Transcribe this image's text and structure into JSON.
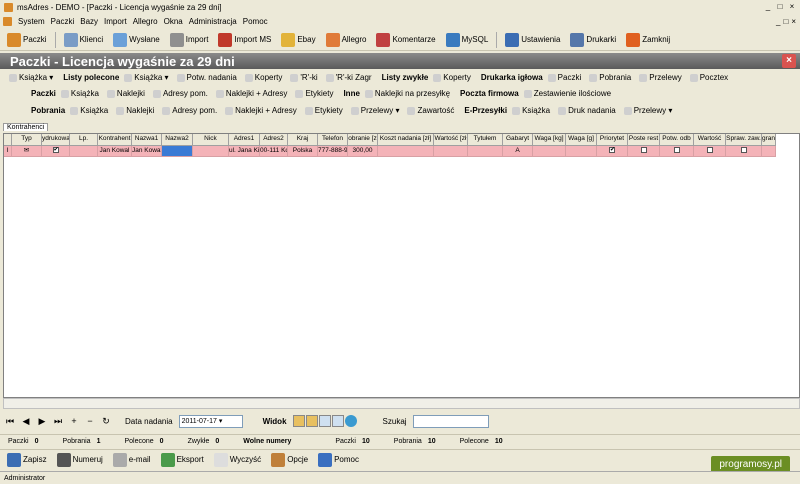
{
  "window": {
    "title": "msAdres - DEMO - [Paczki - Licencja wygaśnie za 29 dni]"
  },
  "menu": [
    "System",
    "Paczki",
    "Bazy",
    "Import",
    "Allegro",
    "Okna",
    "Administracja",
    "Pomoc"
  ],
  "toolbar": [
    {
      "label": "Paczki",
      "color": "#d98a2b"
    },
    {
      "label": "Klienci",
      "color": "#7a9cc6"
    },
    {
      "label": "Wysłane",
      "color": "#6aa0d8"
    },
    {
      "label": "Import",
      "color": "#8f8f8f"
    },
    {
      "label": "Import MS",
      "color": "#c0392b"
    },
    {
      "label": "Ebay",
      "color": "#e2b33a"
    },
    {
      "label": "Allegro",
      "color": "#e07b39"
    },
    {
      "label": "Komentarze",
      "color": "#c04040"
    },
    {
      "label": "MySQL",
      "color": "#3a7bbf"
    },
    {
      "label": "Ustawienia",
      "color": "#3b6db3"
    },
    {
      "label": "Drukarki",
      "color": "#5577aa"
    },
    {
      "label": "Zamknij",
      "color": "#e06020"
    }
  ],
  "header": {
    "title": "Paczki - Licencja wygaśnie za 29 dni"
  },
  "sub1": [
    {
      "t": "i",
      "l": "Książka ▾"
    },
    {
      "t": "g",
      "l": "Listy polecone"
    },
    {
      "t": "i",
      "l": "Książka ▾"
    },
    {
      "t": "i",
      "l": "Potw. nadania"
    },
    {
      "t": "i",
      "l": "Koperty"
    },
    {
      "t": "i",
      "l": "'R'-ki"
    },
    {
      "t": "i",
      "l": "'R'-ki Zagr"
    },
    {
      "t": "g",
      "l": "Listy zwykłe"
    },
    {
      "t": "i",
      "l": "Koperty"
    },
    {
      "t": "g",
      "l": "Drukarka igłowa"
    },
    {
      "t": "i",
      "l": "Paczki"
    },
    {
      "t": "i",
      "l": "Pobrania"
    },
    {
      "t": "i",
      "l": "Przelewy"
    },
    {
      "t": "i",
      "l": "Pocztex"
    }
  ],
  "sub2": [
    {
      "t": "g",
      "l": "Paczki"
    },
    {
      "t": "i",
      "l": "Książka"
    },
    {
      "t": "i",
      "l": "Naklejki"
    },
    {
      "t": "i",
      "l": "Adresy pom."
    },
    {
      "t": "i",
      "l": "Naklejki + Adresy"
    },
    {
      "t": "i",
      "l": "Etykiety"
    },
    {
      "t": "g",
      "l": "Inne"
    },
    {
      "t": "i",
      "l": "Naklejki na przesyłkę"
    },
    {
      "t": "g",
      "l": "Poczta firmowa"
    },
    {
      "t": "i",
      "l": "Zestawienie ilościowe"
    }
  ],
  "sub3": [
    {
      "t": "g",
      "l": "Pobrania"
    },
    {
      "t": "i",
      "l": "Książka"
    },
    {
      "t": "i",
      "l": "Naklejki"
    },
    {
      "t": "i",
      "l": "Adresy pom."
    },
    {
      "t": "i",
      "l": "Naklejki + Adresy"
    },
    {
      "t": "i",
      "l": "Etykiety"
    },
    {
      "t": "i",
      "l": "Przelewy ▾"
    },
    {
      "t": "i",
      "l": "Zawartość"
    },
    {
      "t": "g",
      "l": "E-Przesyłki"
    },
    {
      "t": "i",
      "l": "Książka"
    },
    {
      "t": "i",
      "l": "Druk nadania"
    },
    {
      "t": "i",
      "l": "Przelewy ▾"
    }
  ],
  "tab": "Kontrahenci",
  "columns": [
    "",
    "Typ",
    "ydrukowa",
    "Lp.",
    "Kontrahent",
    "Nazwa1",
    "Nazwa2",
    "Nick",
    "Adres1",
    "Adres2",
    "Kraj",
    "Telefon",
    "obranie [z",
    "Koszt nadania [zł]",
    "Wartość [zł",
    "Tytułem",
    "Gabaryt",
    "Waga [kg]",
    "Waga [g]",
    "Priorytet",
    "Poste rest",
    "Potw. odb",
    "Wartość",
    "Spraw. zaw.",
    "granica"
  ],
  "row": [
    "I",
    "✉",
    "✔",
    "",
    "Jan Kowal",
    "Jan Kowal",
    "",
    "",
    "ul. Jana Ki",
    "00-111 Ko",
    "Polska",
    "777-888-9",
    "300,00",
    "",
    "",
    "",
    "A",
    "",
    "",
    "✔",
    "",
    "",
    "",
    "",
    ""
  ],
  "nav": {
    "date_label": "Data nadania",
    "date_value": "2011-07-17",
    "view_label": "Widok",
    "search_label": "Szukaj",
    "search_value": ""
  },
  "stats": [
    {
      "l": "Paczki",
      "v": "0"
    },
    {
      "l": "Pobrania",
      "v": "1"
    },
    {
      "l": "Polecone",
      "v": "0"
    },
    {
      "l": "Zwykłe",
      "v": "0"
    },
    {
      "l": "Wolne numery",
      "v": "",
      "b": true
    },
    {
      "l": "Paczki",
      "v": "10"
    },
    {
      "l": "Pobrania",
      "v": "10"
    },
    {
      "l": "Polecone",
      "v": "10"
    }
  ],
  "buttons": [
    {
      "label": "Zapisz",
      "color": "#3b6db3"
    },
    {
      "label": "Numeruj",
      "color": "#555"
    },
    {
      "label": "e-mail",
      "color": "#aaa"
    },
    {
      "label": "Eksport",
      "color": "#4a9a4a"
    },
    {
      "label": "Wyczyść",
      "color": "#ddd"
    },
    {
      "label": "Opcje",
      "color": "#c0803a"
    },
    {
      "label": "Pomoc",
      "color": "#3a6fc0"
    }
  ],
  "status": "Administrator",
  "brand": "programosy.pl"
}
